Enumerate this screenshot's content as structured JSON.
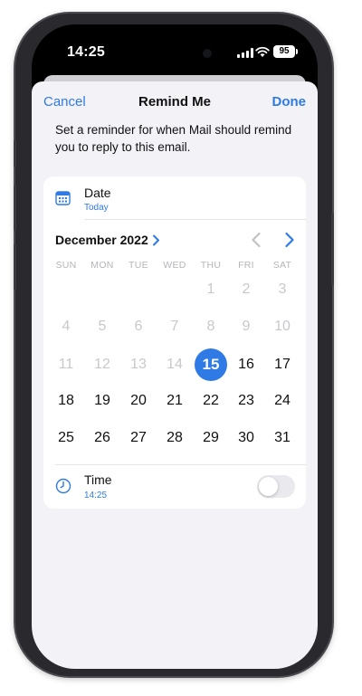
{
  "status": {
    "time": "14:25",
    "battery": "95"
  },
  "nav": {
    "cancel": "Cancel",
    "title": "Remind Me",
    "done": "Done"
  },
  "description": "Set a reminder for when Mail should remind you to reply to this email.",
  "date_row": {
    "label": "Date",
    "value": "Today",
    "icon": "calendar-icon"
  },
  "calendar": {
    "month": "December 2022",
    "weekdays": [
      "SUN",
      "MON",
      "TUE",
      "WED",
      "THU",
      "FRI",
      "SAT"
    ],
    "weeks": [
      [
        "",
        "",
        "",
        "",
        "1",
        "2",
        "3"
      ],
      [
        "4",
        "5",
        "6",
        "7",
        "8",
        "9",
        "10"
      ],
      [
        "11",
        "12",
        "13",
        "14",
        "15",
        "16",
        "17"
      ],
      [
        "18",
        "19",
        "20",
        "21",
        "22",
        "23",
        "24"
      ],
      [
        "25",
        "26",
        "27",
        "28",
        "29",
        "30",
        "31"
      ]
    ],
    "selected": "15"
  },
  "time_row": {
    "label": "Time",
    "value": "14:25",
    "icon": "clock-icon",
    "toggle_on": false
  },
  "colors": {
    "accent": "#2f7ae5",
    "sheet": "#f2f2f7",
    "disabled": "#c8c8cd"
  }
}
